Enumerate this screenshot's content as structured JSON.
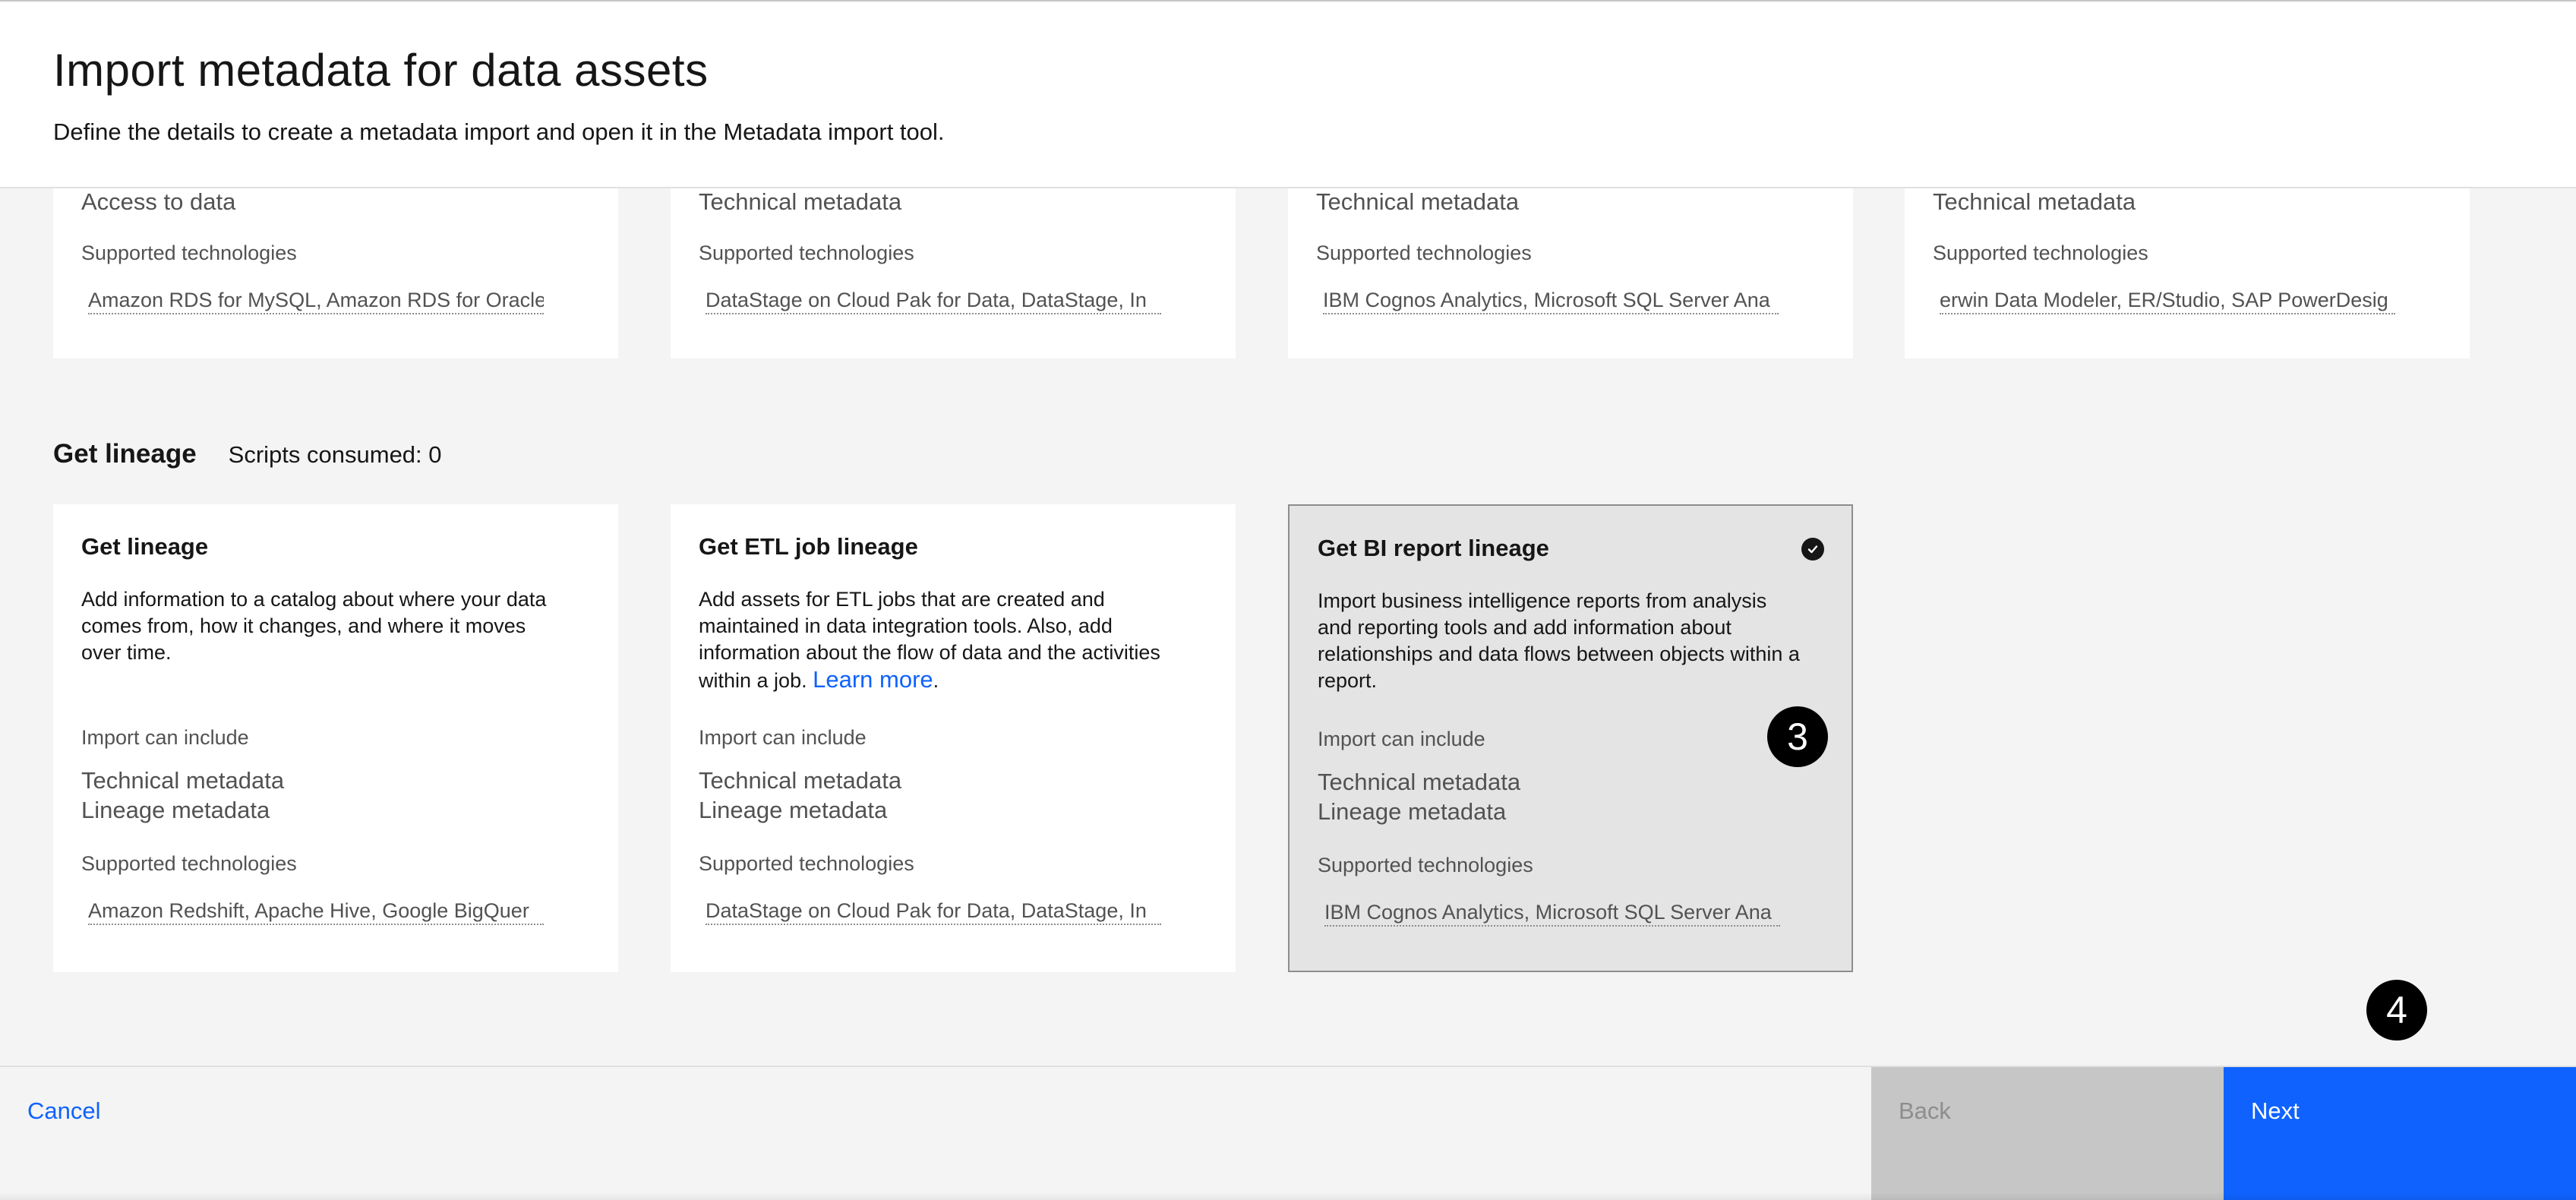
{
  "header": {
    "title": "Import metadata for data assets",
    "subtitle": "Define the details to create a metadata import and open it in the Metadata import tool."
  },
  "top_cards": [
    {
      "category": "Access to data",
      "supported_label": "Supported technologies",
      "technologies": "Amazon RDS for MySQL, Amazon RDS for Oracle"
    },
    {
      "category": "Technical metadata",
      "supported_label": "Supported technologies",
      "technologies": "DataStage on Cloud Pak for Data, DataStage, In"
    },
    {
      "category": "Technical metadata",
      "supported_label": "Supported technologies",
      "technologies": "IBM Cognos Analytics, Microsoft SQL Server Ana"
    },
    {
      "category": "Technical metadata",
      "supported_label": "Supported technologies",
      "technologies": "erwin Data Modeler, ER/Studio, SAP PowerDesig"
    }
  ],
  "lineage_section": {
    "title": "Get lineage",
    "meta": "Scripts consumed: 0"
  },
  "lineage_cards": [
    {
      "title": "Get lineage",
      "description": "Add information to a catalog about where your data comes from, how it changes, and where it moves over time.",
      "include_label": "Import can include",
      "include_items": [
        "Technical metadata",
        "Lineage metadata"
      ],
      "supported_label": "Supported technologies",
      "technologies": "Amazon Redshift, Apache Hive, Google BigQuer"
    },
    {
      "title": "Get ETL job lineage",
      "description": "Add assets for ETL jobs that are created and maintained in data integration tools. Also, add information about the flow of data and the activities within a job.",
      "link_text": "Learn more",
      "link_suffix": ".",
      "include_label": "Import can include",
      "include_items": [
        "Technical metadata",
        "Lineage metadata"
      ],
      "supported_label": "Supported technologies",
      "technologies": "DataStage on Cloud Pak for Data, DataStage, In"
    },
    {
      "title": "Get BI report lineage",
      "selected": true,
      "description": "Import business intelligence reports from analysis and reporting tools and add information about relationships and data flows between objects within a report.",
      "include_label": "Import can include",
      "include_items": [
        "Technical metadata",
        "Lineage metadata"
      ],
      "supported_label": "Supported technologies",
      "technologies": "IBM Cognos Analytics, Microsoft SQL Server Ana"
    }
  ],
  "badges": {
    "step3": "3",
    "step4": "4"
  },
  "footer": {
    "cancel": "Cancel",
    "back": "Back",
    "next": "Next"
  },
  "colors": {
    "accent": "#0f62fe",
    "selected_bg": "#e4e4e4",
    "disabled_bg": "#c6c6c6"
  },
  "icons": {
    "selected_check": "checkmark-filled-icon"
  }
}
